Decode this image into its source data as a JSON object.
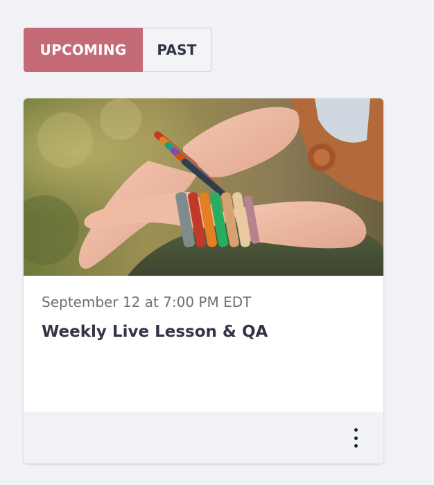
{
  "tabs": {
    "upcoming_label": "UPCOMING",
    "past_label": "PAST",
    "active": "upcoming"
  },
  "event": {
    "image_alt": "Hands with colorful beaded bracelets resting in a meditative pose",
    "date": "September 12 at 7:00 PM EDT",
    "title": "Weekly Live Lesson & QA"
  },
  "footer": {
    "more_icon": "more-vertical-icon"
  },
  "colors": {
    "accent": "#c56b78",
    "background": "#f1f2f5",
    "text_dark": "#333446",
    "text_muted": "#6d6f78"
  }
}
